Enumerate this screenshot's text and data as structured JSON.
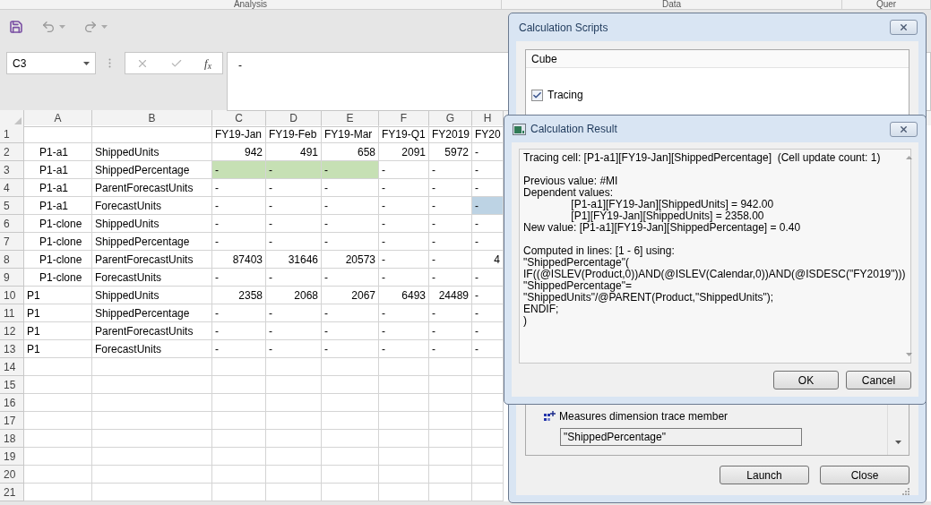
{
  "ribbon_groups": [
    "Analysis",
    "Data",
    "Quer"
  ],
  "name_box": {
    "value": "C3"
  },
  "function_button": "f$_{x}$",
  "formula_bar": {
    "value": "-"
  },
  "sheet": {
    "columns": [
      "A",
      "B",
      "C",
      "D",
      "E",
      "F",
      "G",
      "H"
    ],
    "rows": [
      {
        "number": "1",
        "values": [
          {
            "text": "FY19-Jan",
            "kind": "text"
          },
          {
            "text": "FY19-Feb",
            "kind": "text"
          },
          {
            "text": "FY19-Mar",
            "kind": "text"
          },
          {
            "text": "FY19-Q1",
            "kind": "text"
          },
          {
            "text": "FY2019",
            "kind": "text"
          },
          {
            "text": "FY20",
            "kind": "text"
          }
        ]
      },
      {
        "number": "2",
        "a": "P1-a1",
        "indented": true,
        "b": "ShippedUnits",
        "values": [
          {
            "text": "942",
            "kind": "number"
          },
          {
            "text": "491",
            "kind": "number"
          },
          {
            "text": "658",
            "kind": "number"
          },
          {
            "text": "2091",
            "kind": "number"
          },
          {
            "text": "5972",
            "kind": "number"
          },
          {
            "text": "-",
            "kind": "text"
          }
        ]
      },
      {
        "number": "3",
        "a": "P1-a1",
        "indented": true,
        "b": "ShippedPercentage",
        "values": [
          {
            "text": "-",
            "kind": "text",
            "color": "#c6e0b4"
          },
          {
            "text": "-",
            "kind": "text",
            "color": "#c6e0b4"
          },
          {
            "text": "-",
            "kind": "text",
            "color": "#c6e0b4"
          },
          {
            "text": "-",
            "kind": "text"
          },
          {
            "text": "-",
            "kind": "text"
          },
          {
            "text": "-",
            "kind": "text"
          }
        ]
      },
      {
        "number": "4",
        "a": "P1-a1",
        "indented": true,
        "b": "ParentForecastUnits",
        "values": [
          {
            "text": "-",
            "kind": "text"
          },
          {
            "text": "-",
            "kind": "text"
          },
          {
            "text": "-",
            "kind": "text"
          },
          {
            "text": "-",
            "kind": "text"
          },
          {
            "text": "-",
            "kind": "text"
          },
          {
            "text": "-",
            "kind": "text"
          }
        ]
      },
      {
        "number": "5",
        "a": "P1-a1",
        "indented": true,
        "b": "ForecastUnits",
        "values": [
          {
            "text": "-",
            "kind": "text"
          },
          {
            "text": "-",
            "kind": "text"
          },
          {
            "text": "-",
            "kind": "text"
          },
          {
            "text": "-",
            "kind": "text"
          },
          {
            "text": "-",
            "kind": "text"
          },
          {
            "text": "-",
            "kind": "text",
            "color": "#bdd3e4"
          }
        ]
      },
      {
        "number": "6",
        "a": "P1-clone",
        "indented": true,
        "b": "ShippedUnits",
        "values": [
          {
            "text": "-",
            "kind": "text"
          },
          {
            "text": "-",
            "kind": "text"
          },
          {
            "text": "-",
            "kind": "text"
          },
          {
            "text": "-",
            "kind": "text"
          },
          {
            "text": "-",
            "kind": "text"
          },
          {
            "text": "-",
            "kind": "text"
          }
        ]
      },
      {
        "number": "7",
        "a": "P1-clone",
        "indented": true,
        "b": "ShippedPercentage",
        "values": [
          {
            "text": "-",
            "kind": "text"
          },
          {
            "text": "-",
            "kind": "text"
          },
          {
            "text": "-",
            "kind": "text"
          },
          {
            "text": "-",
            "kind": "text"
          },
          {
            "text": "-",
            "kind": "text"
          },
          {
            "text": "-",
            "kind": "text"
          }
        ]
      },
      {
        "number": "8",
        "a": "P1-clone",
        "indented": true,
        "b": "ParentForecastUnits",
        "values": [
          {
            "text": "87403",
            "kind": "number"
          },
          {
            "text": "31646",
            "kind": "number"
          },
          {
            "text": "20573",
            "kind": "number"
          },
          {
            "text": "-",
            "kind": "text"
          },
          {
            "text": "-",
            "kind": "text"
          },
          {
            "text": "4",
            "kind": "number"
          }
        ]
      },
      {
        "number": "9",
        "a": "P1-clone",
        "indented": true,
        "b": "ForecastUnits",
        "values": [
          {
            "text": "-",
            "kind": "text"
          },
          {
            "text": "-",
            "kind": "text"
          },
          {
            "text": "-",
            "kind": "text"
          },
          {
            "text": "-",
            "kind": "text"
          },
          {
            "text": "-",
            "kind": "text"
          },
          {
            "text": "-",
            "kind": "text"
          }
        ]
      },
      {
        "number": "10",
        "a": "P1",
        "indented": false,
        "b": "ShippedUnits",
        "values": [
          {
            "text": "2358",
            "kind": "number"
          },
          {
            "text": "2068",
            "kind": "number"
          },
          {
            "text": "2067",
            "kind": "number"
          },
          {
            "text": "6493",
            "kind": "number"
          },
          {
            "text": "24489",
            "kind": "number"
          },
          {
            "text": "-",
            "kind": "text"
          }
        ]
      },
      {
        "number": "11",
        "a": "P1",
        "indented": false,
        "b": "ShippedPercentage",
        "values": [
          {
            "text": "-",
            "kind": "text"
          },
          {
            "text": "-",
            "kind": "text"
          },
          {
            "text": "-",
            "kind": "text"
          },
          {
            "text": "-",
            "kind": "text"
          },
          {
            "text": "-",
            "kind": "text"
          },
          {
            "text": "-",
            "kind": "text"
          }
        ]
      },
      {
        "number": "12",
        "a": "P1",
        "indented": false,
        "b": "ParentForecastUnits",
        "values": [
          {
            "text": "-",
            "kind": "text"
          },
          {
            "text": "-",
            "kind": "text"
          },
          {
            "text": "-",
            "kind": "text"
          },
          {
            "text": "-",
            "kind": "text"
          },
          {
            "text": "-",
            "kind": "text"
          },
          {
            "text": "-",
            "kind": "text"
          }
        ]
      },
      {
        "number": "13",
        "a": "P1",
        "indented": false,
        "b": "ForecastUnits",
        "values": [
          {
            "text": "-",
            "kind": "text"
          },
          {
            "text": "-",
            "kind": "text"
          },
          {
            "text": "-",
            "kind": "text"
          },
          {
            "text": "-",
            "kind": "text"
          },
          {
            "text": "-",
            "kind": "text"
          },
          {
            "text": "-",
            "kind": "text"
          }
        ]
      },
      {
        "number": "14"
      },
      {
        "number": "15"
      },
      {
        "number": "16"
      },
      {
        "number": "17"
      },
      {
        "number": "18"
      },
      {
        "number": "19"
      },
      {
        "number": "20"
      },
      {
        "number": "21"
      }
    ]
  },
  "scripts_dialog": {
    "title": "Calculation Scripts",
    "list_header": "Cube",
    "items": [
      {
        "label": "Tracing",
        "checked": true
      }
    ],
    "trace_label": "Measures dimension trace member",
    "trace_value": "\"ShippedPercentage\"",
    "buttons": [
      "Launch",
      "Close"
    ]
  },
  "result_dialog": {
    "title": "Calculation Result",
    "paragraphs": [
      {
        "lines": [
          "Tracing cell: [P1-a1][FY19-Jan][ShippedPercentage]  (Cell update count: 1)"
        ]
      },
      {
        "lines": [
          "Previous value: #MI",
          "Dependent values:",
          "\t[P1-a1][FY19-Jan][ShippedUnits] = 942.00",
          "\t[P1][FY19-Jan][ShippedUnits] = 2358.00",
          "New value: [P1-a1][FY19-Jan][ShippedPercentage] = 0.40"
        ]
      },
      {
        "lines": [
          "Computed in lines: [1 - 6] using:",
          "\"ShippedPercentage\"(",
          "IF((@ISLEV(Product,0))AND(@ISLEV(Calendar,0))AND(@ISDESC(\"FY2019\")))",
          "\"ShippedPercentage\"=",
          "\"ShippedUnits\"/@PARENT(Product,\"ShippedUnits\");",
          "ENDIF;",
          ")"
        ]
      }
    ],
    "buttons": [
      "OK",
      "Cancel"
    ]
  }
}
